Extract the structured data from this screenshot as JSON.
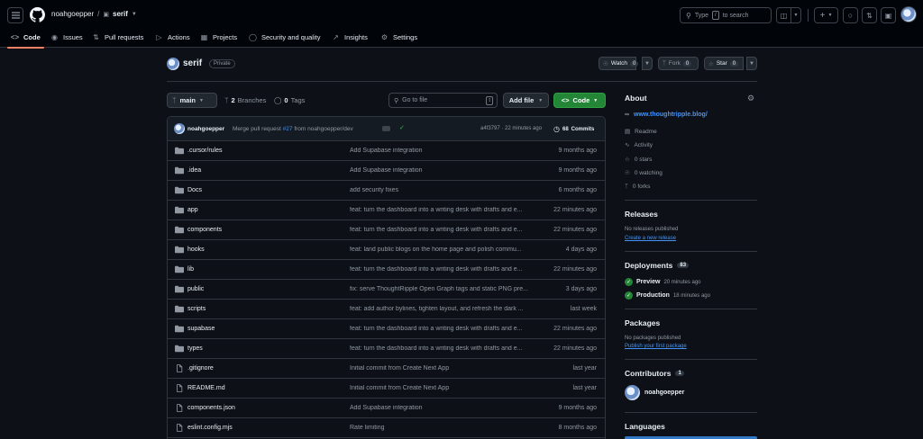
{
  "header": {
    "owner": "noahgoepper",
    "separator": "/",
    "repo": "serif",
    "search_placeholder_pre": "Type",
    "search_key": "/",
    "search_placeholder_post": "to search"
  },
  "tabs": [
    {
      "label": "Code",
      "icon": "code-icon"
    },
    {
      "label": "Issues",
      "icon": "issue-icon"
    },
    {
      "label": "Pull requests",
      "icon": "pull-request-icon"
    },
    {
      "label": "Actions",
      "icon": "play-icon"
    },
    {
      "label": "Projects",
      "icon": "table-icon"
    },
    {
      "label": "Security and quality",
      "icon": "shield-icon"
    },
    {
      "label": "Insights",
      "icon": "graph-icon"
    },
    {
      "label": "Settings",
      "icon": "gear-icon"
    }
  ],
  "repo": {
    "name": "serif",
    "visibility": "Private",
    "watch_label": "Watch",
    "watch_count": "0",
    "fork_label": "Fork",
    "fork_count": "0",
    "star_label": "Star",
    "star_count": "0"
  },
  "filenav": {
    "branch": "main",
    "branches_count": "2",
    "branches_label": "Branches",
    "tags_count": "0",
    "tags_label": "Tags",
    "goto_placeholder": "Go to file",
    "goto_key": "t",
    "add_file_label": "Add file",
    "code_label": "Code"
  },
  "commit": {
    "author": "noahgoepper",
    "message_pre": "Merge pull request",
    "pr": "#27",
    "message_post": "from noahgoepper/dev",
    "hash_time": "a4f3797 · 22 minutes ago",
    "commits_count": "68",
    "commits_label": "Commits"
  },
  "files": [
    {
      "name": ".cursor/rules",
      "type": "folder",
      "message": "Add Supabase integration",
      "date": "9 months ago"
    },
    {
      "name": ".idea",
      "type": "folder",
      "message": "Add Supabase integration",
      "date": "9 months ago"
    },
    {
      "name": "Docs",
      "type": "folder",
      "message": "add security fixes",
      "date": "6 months ago"
    },
    {
      "name": "app",
      "type": "folder",
      "message": "feat: turn the dashboard into a writing desk with drafts and e...",
      "date": "22 minutes ago"
    },
    {
      "name": "components",
      "type": "folder",
      "message": "feat: turn the dashboard into a writing desk with drafts and e...",
      "date": "22 minutes ago"
    },
    {
      "name": "hooks",
      "type": "folder",
      "message": "feat: land public blogs on the home page and polish commu...",
      "date": "4 days ago"
    },
    {
      "name": "lib",
      "type": "folder",
      "message": "feat: turn the dashboard into a writing desk with drafts and e...",
      "date": "22 minutes ago"
    },
    {
      "name": "public",
      "type": "folder",
      "message": "fix: serve ThoughtRipple Open Graph tags and static PNG pre...",
      "date": "3 days ago"
    },
    {
      "name": "scripts",
      "type": "folder",
      "message": "feat: add author bylines, tighten layout, and refresh the dark ...",
      "date": "last week"
    },
    {
      "name": "supabase",
      "type": "folder",
      "message": "feat: turn the dashboard into a writing desk with drafts and e...",
      "date": "22 minutes ago"
    },
    {
      "name": "types",
      "type": "folder",
      "message": "feat: turn the dashboard into a writing desk with drafts and e...",
      "date": "22 minutes ago"
    },
    {
      "name": ".gitignore",
      "type": "file",
      "message": "Initial commit from Create Next App",
      "date": "last year"
    },
    {
      "name": "README.md",
      "type": "file",
      "message": "Initial commit from Create Next App",
      "date": "last year"
    },
    {
      "name": "components.json",
      "type": "file",
      "message": "Add Supabase integration",
      "date": "9 months ago"
    },
    {
      "name": "eslint.config.mjs",
      "type": "file",
      "message": "Rate limiting",
      "date": "8 months ago"
    }
  ],
  "sidebar": {
    "about_title": "About",
    "website": "www.thoughtripple.blog/",
    "readme": "Readme",
    "activity": "Activity",
    "stars": "0 stars",
    "watching": "0 watching",
    "forks": "0 forks",
    "releases_title": "Releases",
    "no_releases": "No releases published",
    "create_release": "Create a new release",
    "deployments_title": "Deployments",
    "deployments_count": "83",
    "deployments": [
      {
        "name": "Preview",
        "time": "20 minutes ago"
      },
      {
        "name": "Production",
        "time": "18 minutes ago"
      }
    ],
    "packages_title": "Packages",
    "no_packages": "No packages published",
    "publish_package": "Publish your first package",
    "contributors_title": "Contributors",
    "contributors_count": "1",
    "contributor": "noahgoepper",
    "languages_title": "Languages"
  },
  "colors": {
    "background": "#0d1117",
    "accent_tab": "#f78166",
    "link": "#4493f8",
    "primary_button": "#238636"
  }
}
